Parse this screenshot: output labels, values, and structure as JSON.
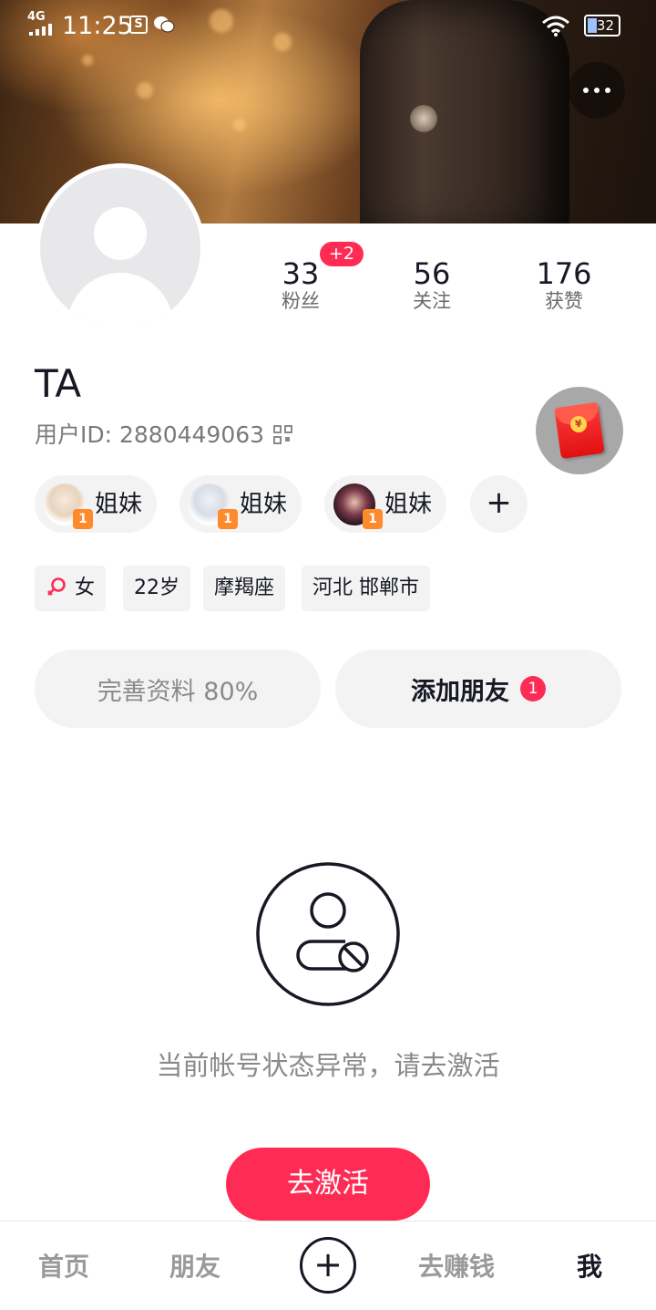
{
  "status_bar": {
    "network": "4G",
    "time": "11:25",
    "app_icon_1": "S",
    "battery": "32"
  },
  "profile": {
    "name": "TA",
    "user_id_label": "用户ID: 2880449063"
  },
  "stats": [
    {
      "value": "33",
      "label": "粉丝",
      "badge": "+2"
    },
    {
      "value": "56",
      "label": "关注"
    },
    {
      "value": "176",
      "label": "获赞"
    }
  ],
  "relations": [
    {
      "label": "姐妹",
      "level": "1"
    },
    {
      "label": "姐妹",
      "level": "1"
    },
    {
      "label": "姐妹",
      "level": "1"
    }
  ],
  "add_relation_symbol": "+",
  "tags": {
    "gender": "女",
    "age": "22岁",
    "zodiac": "摩羯座",
    "location": "河北 邯郸市"
  },
  "actions": {
    "complete_profile": "完善资料 80%",
    "add_friend": "添加朋友",
    "add_friend_badge": "1"
  },
  "account_state": {
    "message": "当前帐号状态异常，请去激活",
    "activate_button": "去激活"
  },
  "redpacket_symbol": "¥",
  "bottom_nav": {
    "home": "首页",
    "friends": "朋友",
    "create": "+",
    "earn": "去赚钱",
    "me": "我"
  },
  "colors": {
    "accent": "#fe2c55",
    "text_primary": "#161823",
    "text_secondary": "#8a8a8a",
    "chip_bg": "#f3f3f4"
  }
}
